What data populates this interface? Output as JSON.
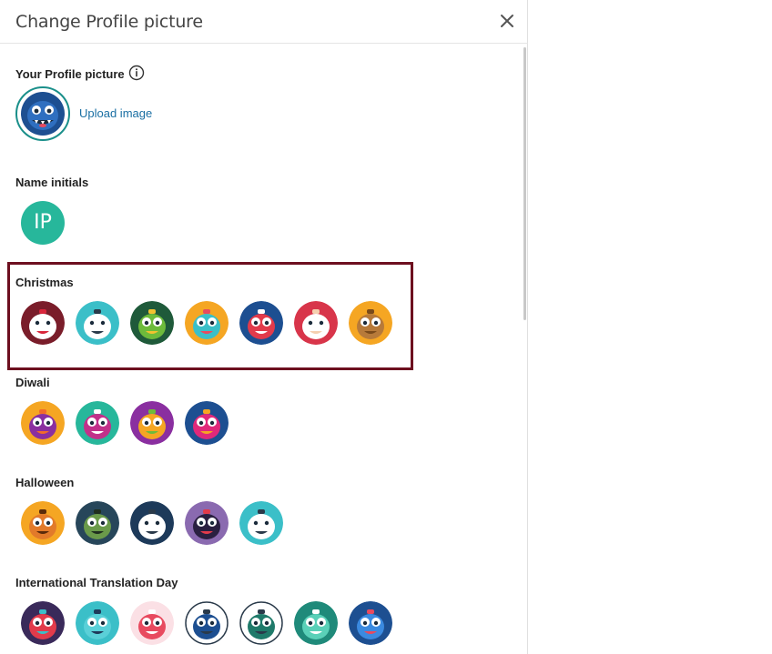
{
  "dialog": {
    "title": "Change Profile picture",
    "close_icon": "close-icon"
  },
  "profile": {
    "heading": "Your Profile picture",
    "info_icon": "info-icon",
    "upload_label": "Upload image"
  },
  "initials": {
    "heading": "Name initials",
    "text": "IP",
    "color": "#27b79b"
  },
  "categories": [
    {
      "key": "christmas",
      "heading": "Christmas",
      "avatars": [
        {
          "name": "candy-cane-avatar",
          "bg": "#7a1d2a",
          "face": "#ffffff",
          "accent": "#d9263b"
        },
        {
          "name": "snowman-avatar",
          "bg": "#3bbfc8",
          "face": "#ffffff",
          "accent": "#2a3a4a"
        },
        {
          "name": "christmas-tree-avatar",
          "bg": "#1f5a3a",
          "face": "#6dbb3b",
          "accent": "#f2c230"
        },
        {
          "name": "gift-box-avatar",
          "bg": "#f5a623",
          "face": "#3bbfc8",
          "accent": "#e84a5f"
        },
        {
          "name": "stocking-avatar",
          "bg": "#1d4f91",
          "face": "#e23b4b",
          "accent": "#ffffff"
        },
        {
          "name": "santa-avatar",
          "bg": "#d8354a",
          "face": "#ffffff",
          "accent": "#f5d0b0"
        },
        {
          "name": "reindeer-avatar",
          "bg": "#f5a623",
          "face": "#b77a3a",
          "accent": "#7a4a1a"
        }
      ]
    },
    {
      "key": "diwali",
      "heading": "Diwali",
      "avatars": [
        {
          "name": "candle-avatar",
          "bg": "#f5a623",
          "face": "#8a2fa0",
          "accent": "#f26b2a"
        },
        {
          "name": "lotus-avatar",
          "bg": "#27b79b",
          "face": "#c2308a",
          "accent": "#ffffff"
        },
        {
          "name": "flower-avatar",
          "bg": "#8a2fa0",
          "face": "#f5a623",
          "accent": "#6dbb3b"
        },
        {
          "name": "diya-avatar",
          "bg": "#1d4f91",
          "face": "#e0287a",
          "accent": "#f5a623"
        }
      ]
    },
    {
      "key": "halloween",
      "heading": "Halloween",
      "avatars": [
        {
          "name": "pumpkin-avatar",
          "bg": "#f5a623",
          "face": "#e27a2a",
          "accent": "#5a2a0a"
        },
        {
          "name": "frankenstein-avatar",
          "bg": "#27465a",
          "face": "#6a9a4a",
          "accent": "#1f2f1f"
        },
        {
          "name": "skull-avatar",
          "bg": "#1d3a5a",
          "face": "#ffffff",
          "accent": "#2a3a4a"
        },
        {
          "name": "bat-avatar",
          "bg": "#8a6ab0",
          "face": "#2a2040",
          "accent": "#e23b4b"
        },
        {
          "name": "ghost-avatar",
          "bg": "#3bbfc8",
          "face": "#ffffff",
          "accent": "#2a3a4a"
        }
      ]
    },
    {
      "key": "translation",
      "heading": "International Translation Day",
      "avatars": [
        {
          "name": "pixel-monster-avatar",
          "bg": "#3a2a5a",
          "face": "#e23b4b",
          "accent": "#3bbfc8"
        },
        {
          "name": "cyclops-avatar",
          "bg": "#3bbfc8",
          "face": "#5ad0d8",
          "accent": "#1f3a5a"
        },
        {
          "name": "red-monster-avatar",
          "bg": "#fbe0e5",
          "face": "#e84a5f",
          "accent": "#ffffff"
        },
        {
          "name": "speech-bubble-avatar",
          "bg": "#ffffff",
          "face": "#1d4f91",
          "accent": "#2a3a4a"
        },
        {
          "name": "chat-bubble-avatar",
          "bg": "#ffffff",
          "face": "#1f7a6a",
          "accent": "#2a3a4a"
        },
        {
          "name": "globe-teal-avatar",
          "bg": "#1f8a7a",
          "face": "#5ad0b8",
          "accent": "#ffffff"
        },
        {
          "name": "globe-blue-avatar",
          "bg": "#1d4f91",
          "face": "#3b8ae0",
          "accent": "#e84a5f"
        }
      ]
    }
  ],
  "colors": {
    "highlight": "#6d0f1f",
    "link": "#1a6fa3",
    "profile_ring": "#1a8f8a"
  }
}
